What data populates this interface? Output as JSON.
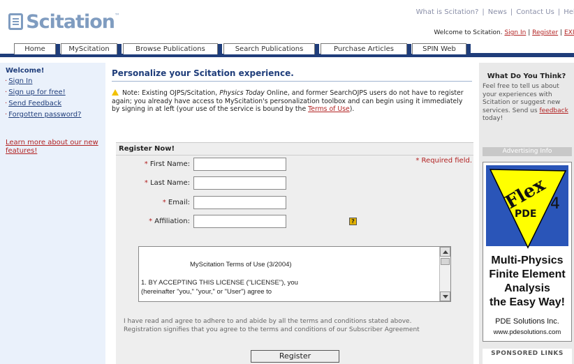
{
  "header": {
    "logo_text": "Scitation",
    "top_links": [
      "What is Scitation?",
      "News",
      "Contact Us",
      "Help"
    ],
    "welcome_text": "Welcome to Scitation.",
    "sign_in": "Sign In",
    "register": "Register",
    "exit": "EXIT",
    "sep": "|"
  },
  "tabs": [
    "Home",
    "MyScitation",
    "Browse Publications",
    "Search Publications",
    "Purchase Articles",
    "SPIN Web"
  ],
  "sidebar": {
    "welcome": "Welcome!",
    "items": [
      "Sign In",
      "Sign up for free!",
      "Send Feedback",
      "Forgotten password?"
    ],
    "learn_more_1": "Learn more about our new",
    "learn_more_2": "features!"
  },
  "main": {
    "title": "Personalize your Scitation experience.",
    "note_1": "Note: Existing OJPS/Scitation,",
    "note_italic": "Physics Today",
    "note_2": "Online, and former SearchOJPS users do not have to register again; you already have access to MyScitation's personalization toolbox and can begin using it immediately by signing in at left (your use of the service is bound by the",
    "note_link": "Terms of Use",
    "note_end": ").",
    "register_heading": "Register Now!",
    "required_note": "* Required field.",
    "star": "*",
    "fields": {
      "first_name": "First Name:",
      "last_name": "Last Name:",
      "email": "Email:",
      "affiliation": "Affiliation:"
    },
    "help_icon": "?",
    "terms_title": "MyScitation Terms of Use (3/2004)",
    "terms_p1": "1.  BY ACCEPTING THIS LICENSE (\"LICENSE\"), you",
    "terms_p2": "(hereinafter \"you,\" \"your,\" or \"User\") agree to",
    "agree_1": "I have read and agree to adhere to and abide by all the terms and conditions stated above.",
    "agree_2": "Registration signifies that you agree to the terms and conditions of our Subscriber Agreement",
    "register_button": "Register"
  },
  "right": {
    "heading": "What Do You Think?",
    "text_1": "Feel free to tell us about your experiences with Scitation or suggest new services. Send us",
    "feedback_link": "feedback",
    "text_2": "today!",
    "advertising": "Advertising Info",
    "ad_flex": "Flex",
    "ad_pde": "PDE",
    "ad_num": "4",
    "ad_lines": [
      "Multi-Physics",
      "Finite Element",
      "Analysis",
      "the Easy Way!"
    ],
    "ad_company": "PDE Solutions Inc.",
    "ad_url": "www.pdesolutions.com",
    "sponsored": "SPONSORED LINKS"
  },
  "colors": {
    "navy": "#1f3d7a",
    "link_red": "#b22222",
    "ad_yellow": "#ffff00",
    "ad_blue": "#2a55b8"
  }
}
